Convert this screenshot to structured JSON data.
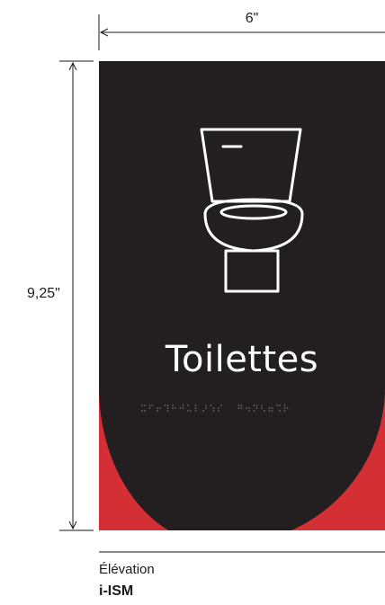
{
  "dimensions": {
    "width_label": "6\"",
    "height_label": "9,25\""
  },
  "sign": {
    "title": "Toilettes",
    "icon": "toilet-icon",
    "braille": "braille-dots",
    "colors": {
      "background": "#231f20",
      "accent": "#d32f34",
      "foreground": "#ffffff"
    }
  },
  "caption": {
    "label": "Élévation",
    "code": "i-ISM"
  }
}
